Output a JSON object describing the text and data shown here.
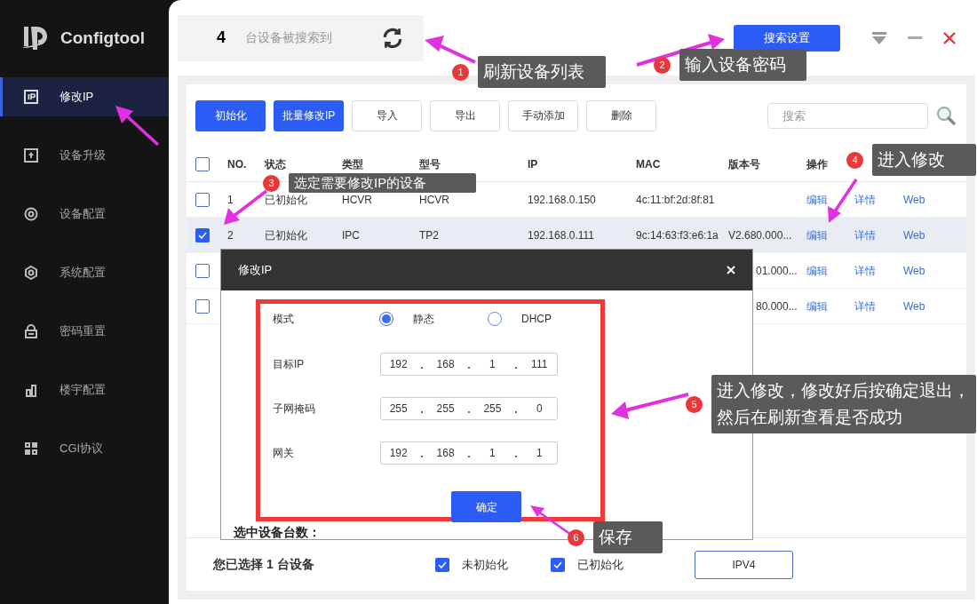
{
  "sidebar": {
    "logo": "Configtool",
    "items": [
      {
        "label": "修改IP",
        "selected": true
      },
      {
        "label": "设备升级",
        "selected": false
      },
      {
        "label": "设备配置",
        "selected": false
      },
      {
        "label": "系统配置",
        "selected": false
      },
      {
        "label": "密码重置",
        "selected": false
      },
      {
        "label": "楼宇配置",
        "selected": false
      },
      {
        "label": "CGI协议",
        "selected": false
      }
    ]
  },
  "header": {
    "count": "4",
    "count_label": "台设备被搜索到",
    "search_settings_button": "搜索设置"
  },
  "toolbar": {
    "buttons": [
      {
        "label": "初始化",
        "kind": "primary"
      },
      {
        "label": "批量修改IP",
        "kind": "primary"
      },
      {
        "label": "导入",
        "kind": "outline"
      },
      {
        "label": "导出",
        "kind": "outline"
      },
      {
        "label": "手动添加",
        "kind": "outline"
      },
      {
        "label": "删除",
        "kind": "outline"
      }
    ],
    "search": {
      "placeholder": "搜索"
    }
  },
  "table": {
    "select_all_checked": false,
    "columns": [
      "NO.",
      "状态",
      "类型",
      "型号",
      "IP",
      "MAC",
      "版本号",
      "操作"
    ],
    "rows": [
      {
        "checked": false,
        "selected": false,
        "cells": [
          "1",
          "已初始化",
          "HCVR",
          "HCVR",
          "192.168.0.150",
          "4c:11:bf:2d:8f:81",
          null
        ],
        "actions": [
          "编辑",
          "详情",
          "Web"
        ]
      },
      {
        "checked": true,
        "selected": true,
        "cells": [
          "2",
          "已初始化",
          "IPC",
          "TP2",
          "192.168.0.111",
          "9c:14:63:f3:e6:1a",
          "V2.680.000..."
        ],
        "actions": [
          "编辑",
          "详情",
          "Web"
        ]
      },
      {
        "checked": false,
        "selected": false,
        "cells": [
          null,
          null,
          null,
          null,
          null,
          null,
          "01.000..."
        ],
        "actions": [
          "编辑",
          "详情",
          "Web"
        ]
      },
      {
        "checked": false,
        "selected": false,
        "cells": [
          null,
          null,
          null,
          null,
          null,
          null,
          "80.000..."
        ],
        "actions": [
          "编辑",
          "详情",
          "Web"
        ]
      }
    ]
  },
  "dialog": {
    "title": "修改IP",
    "mode": {
      "label": "模式",
      "options": [
        {
          "label": "静态",
          "selected": true
        },
        {
          "label": "DHCP",
          "selected": false
        }
      ]
    },
    "fields": [
      {
        "label": "目标IP",
        "octets": [
          "192",
          "168",
          "1",
          "111"
        ]
      },
      {
        "label": "子网掩码",
        "octets": [
          "255",
          "255",
          "255",
          "0"
        ]
      },
      {
        "label": "网关",
        "octets": [
          "192",
          "168",
          "1",
          "1"
        ]
      }
    ],
    "confirm_button": "确定",
    "selected_count_label": "选中设备台数："
  },
  "footer": {
    "summary": "您已选择 1 台设备",
    "filters": [
      {
        "label": "未初始化",
        "checked": true
      },
      {
        "label": "已初始化",
        "checked": true
      }
    ],
    "ipv4_button": "IPV4"
  },
  "annotations": [
    {
      "number": "1",
      "text": "刷新设备列表"
    },
    {
      "number": "2",
      "text": "输入设备密码"
    },
    {
      "number": "3",
      "text": "选定需要修改IP的设备"
    },
    {
      "number": "4",
      "text": "进入修改"
    },
    {
      "number": "5",
      "text": "进入修改，修改好后按确定退出，然后在刷新查看是否成功"
    },
    {
      "number": "6",
      "text": "保存"
    }
  ]
}
